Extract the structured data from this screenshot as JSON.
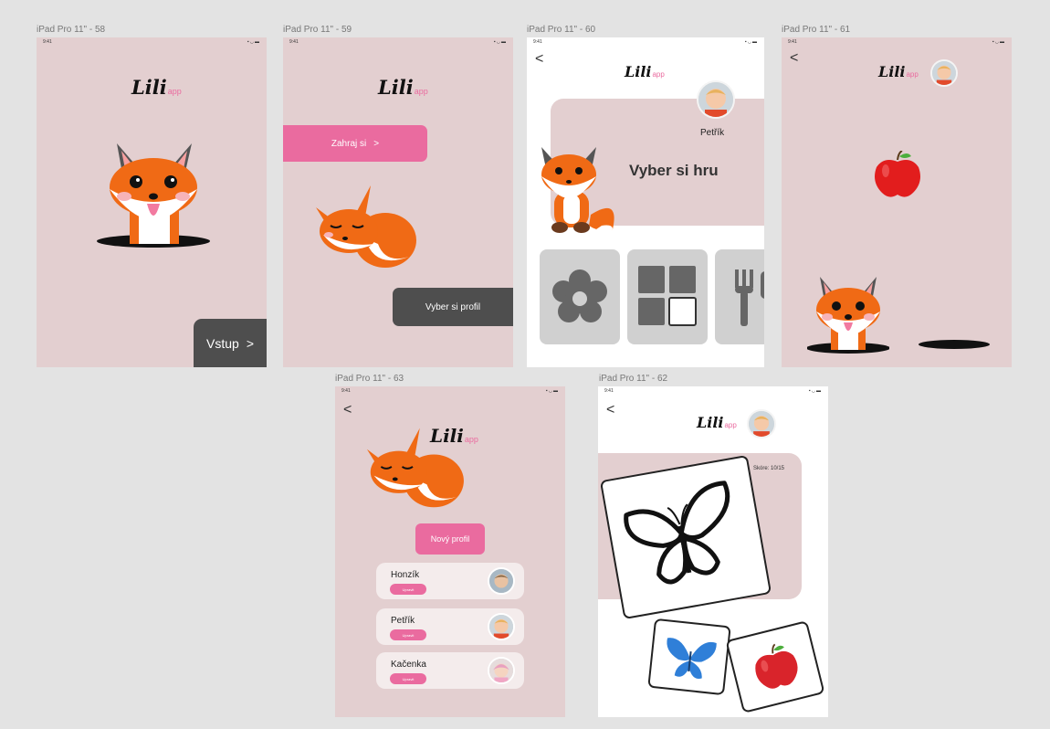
{
  "frames": {
    "f58": {
      "label": "iPad Pro 11\" - 58",
      "status_time": "9:41",
      "status_icons": "▪◡▬",
      "logo_main": "Lili",
      "logo_app": "app",
      "enter_label": "Vstup",
      "enter_chevron": ">"
    },
    "f59": {
      "label": "iPad Pro 11\" - 59",
      "status_time": "9:41",
      "status_icons": "▪◡▬",
      "logo_main": "Lili",
      "logo_app": "app",
      "play_label": "Zahraj si",
      "play_chevron": ">",
      "profile_label": "Vyber si profil"
    },
    "f60": {
      "label": "iPad Pro 11\" - 60",
      "status_time": "9:41",
      "status_icons": "▪◡▬",
      "back": "<",
      "logo_main": "Lili",
      "logo_app": "app",
      "user_name": "Petřík",
      "heading": "Vyber si hru",
      "games": [
        "flower-icon",
        "grid-icon",
        "fork-icon"
      ]
    },
    "f61": {
      "label": "iPad Pro 11\" - 61",
      "status_time": "9:41",
      "status_icons": "▪◡▬",
      "back": "<",
      "logo_main": "Lili",
      "logo_app": "app"
    },
    "f63": {
      "label": "iPad Pro 11\" - 63",
      "status_time": "9:41",
      "status_icons": "▪◡▬",
      "back": "<",
      "logo_main": "Lili",
      "logo_app": "app",
      "new_profile": "Nový profil",
      "profiles": [
        {
          "name": "Honzík",
          "edit": "Upravit"
        },
        {
          "name": "Petřík",
          "edit": "Upravit"
        },
        {
          "name": "Kačenka",
          "edit": "Upravit"
        }
      ]
    },
    "f62": {
      "label": "iPad Pro 11\" - 62",
      "status_time": "9:41",
      "status_icons": "▪◡▬",
      "back": "<",
      "logo_main": "Lili",
      "logo_app": "app",
      "score": "Skóre: 10/15"
    }
  },
  "colors": {
    "background": "#e3e3e3",
    "frame_pink": "#e3cfd0",
    "accent_pink": "#ea6b9f",
    "dark_button": "#4e4e4e",
    "fox_orange": "#f06a15",
    "tile_gray": "#d0d0d0"
  }
}
